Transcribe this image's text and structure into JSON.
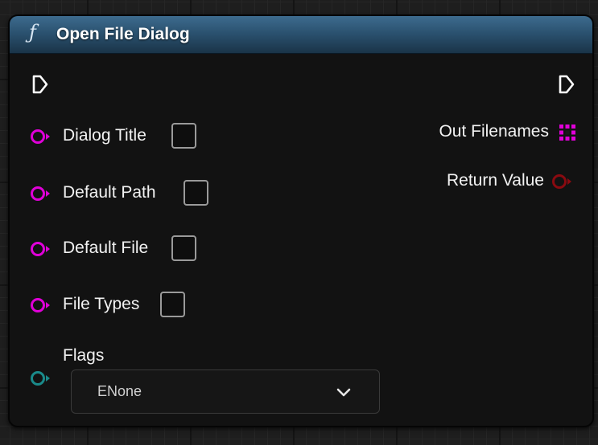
{
  "node": {
    "title": "Open File Dialog",
    "header_icon": "function-icon",
    "header_icon_glyph": "ƒ",
    "colors": {
      "header": "#2b5270",
      "string_pin": "#e000d8",
      "array_pin": "#e000d8",
      "return_pin": "#8a0a10",
      "enum_pin": "#1a8a8a",
      "exec_pin": "#ffffff"
    }
  },
  "inputs": [
    {
      "label": "Dialog Title",
      "type": "string",
      "value": ""
    },
    {
      "label": "Default Path",
      "type": "string",
      "value": ""
    },
    {
      "label": "Default File",
      "type": "string",
      "value": ""
    },
    {
      "label": "File Types",
      "type": "string",
      "value": ""
    },
    {
      "label": "Flags",
      "type": "enum",
      "selected": "ENone"
    }
  ],
  "outputs": [
    {
      "label": "Out Filenames",
      "type": "string-array"
    },
    {
      "label": "Return Value",
      "type": "bool"
    }
  ]
}
